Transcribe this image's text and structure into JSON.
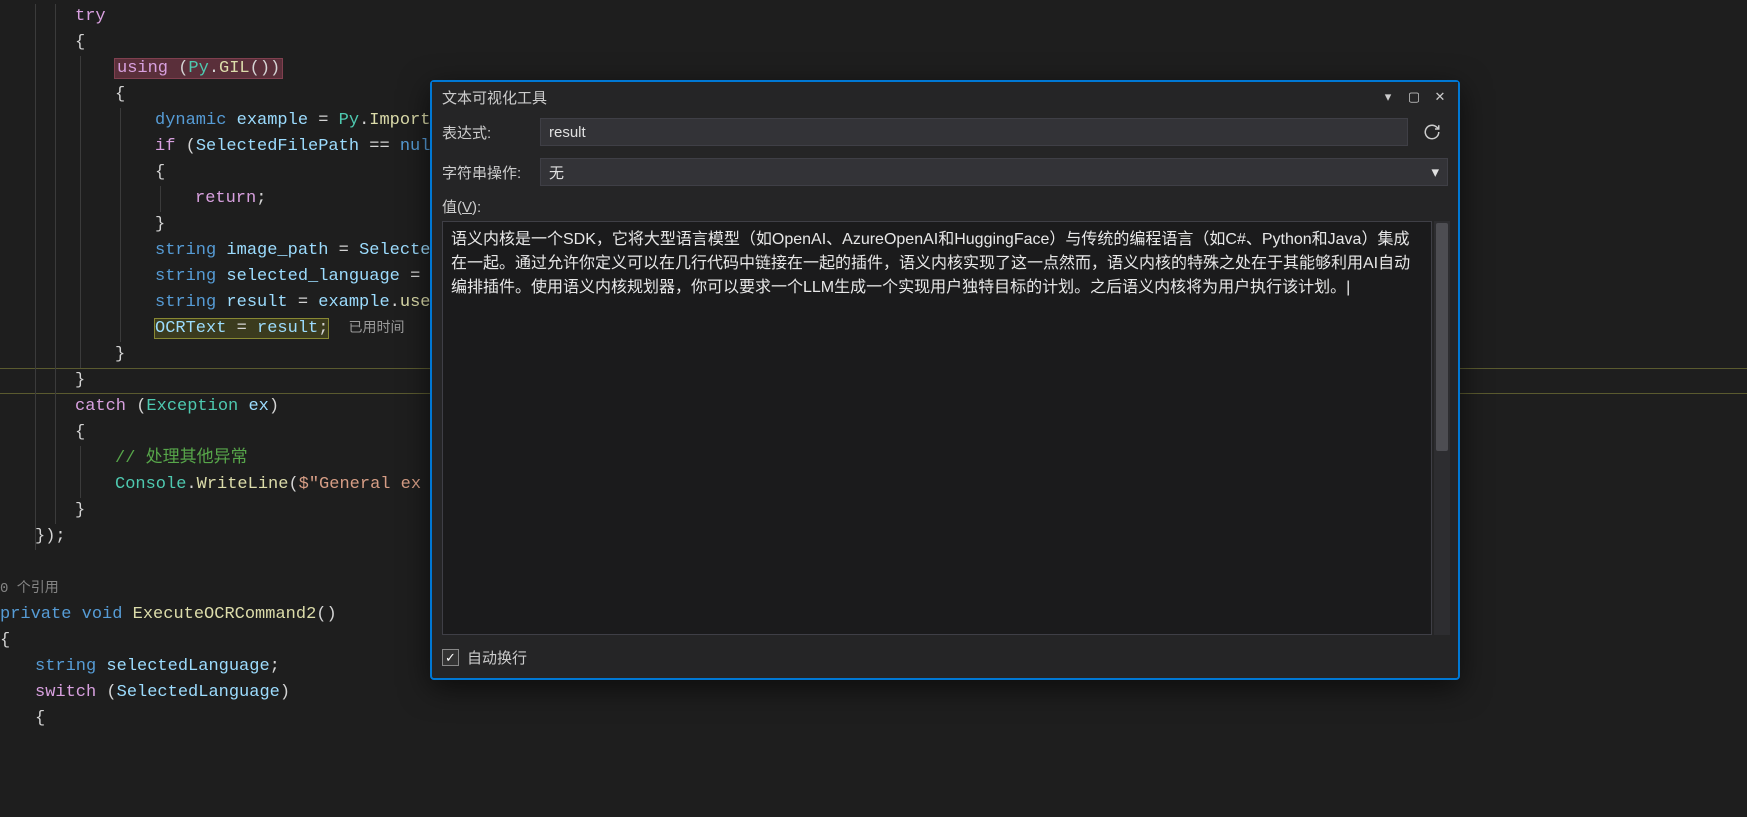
{
  "code": {
    "try_kw": "try",
    "using_kw": "using",
    "py_class": "Py",
    "gil_method": "GIL",
    "dynamic_kw": "dynamic",
    "example_var": "example",
    "import_method": "Import",
    "if_kw": "if",
    "selectedFilePath": "SelectedFilePath",
    "null_kw": "nul",
    "return_kw": "return",
    "string_kw": "string",
    "image_path_var": "image_path",
    "selecte_rhs": "Selecte",
    "selected_language_var": "selected_language",
    "result_var": "result",
    "use_method": "use",
    "ocrtext_var": "OCRText",
    "result_rhs": "result",
    "elapsed_label": "已用时间",
    "catch_kw": "catch",
    "exception_class": "Exception",
    "ex_var": "ex",
    "comment_handle": "// 处理其他异常",
    "console_class": "Console",
    "writeline_method": "WriteLine",
    "general_str": "$\"General ex",
    "codelens_refs_prefix": "0",
    "codelens_refs_suffix": " 个引用",
    "private_kw": "private",
    "void_kw": "void",
    "executeocr_method": "ExecuteOCRCommand2",
    "selectedLanguage_local": "selectedLanguage",
    "switch_kw": "switch",
    "SelectedLanguage_prop": "SelectedLanguage"
  },
  "visualizer": {
    "title": "文本可视化工具",
    "expression_label": "表达式:",
    "expression_value": "result",
    "string_op_label": "字符串操作:",
    "string_op_value": "无",
    "value_label_prefix": "值(",
    "value_label_key": "V",
    "value_label_suffix": "):",
    "value_text": "语义内核是一个SDK，它将大型语言模型（如OpenAI、AzureOpenAI和HuggingFace）与传统的编程语言（如C#、Python和Java）集成在一起。通过允许你定义可以在几行代码中链接在一起的插件，语义内核实现了这一点然而，语义内核的特殊之处在于其能够利用AI自动编排插件。使用语义内核规划器，你可以要求一个LLM生成一个实现用户独特目标的计划。之后语义内核将为用户执行该计划。|",
    "wrap_label": "自动换行",
    "wrap_checked": true
  }
}
